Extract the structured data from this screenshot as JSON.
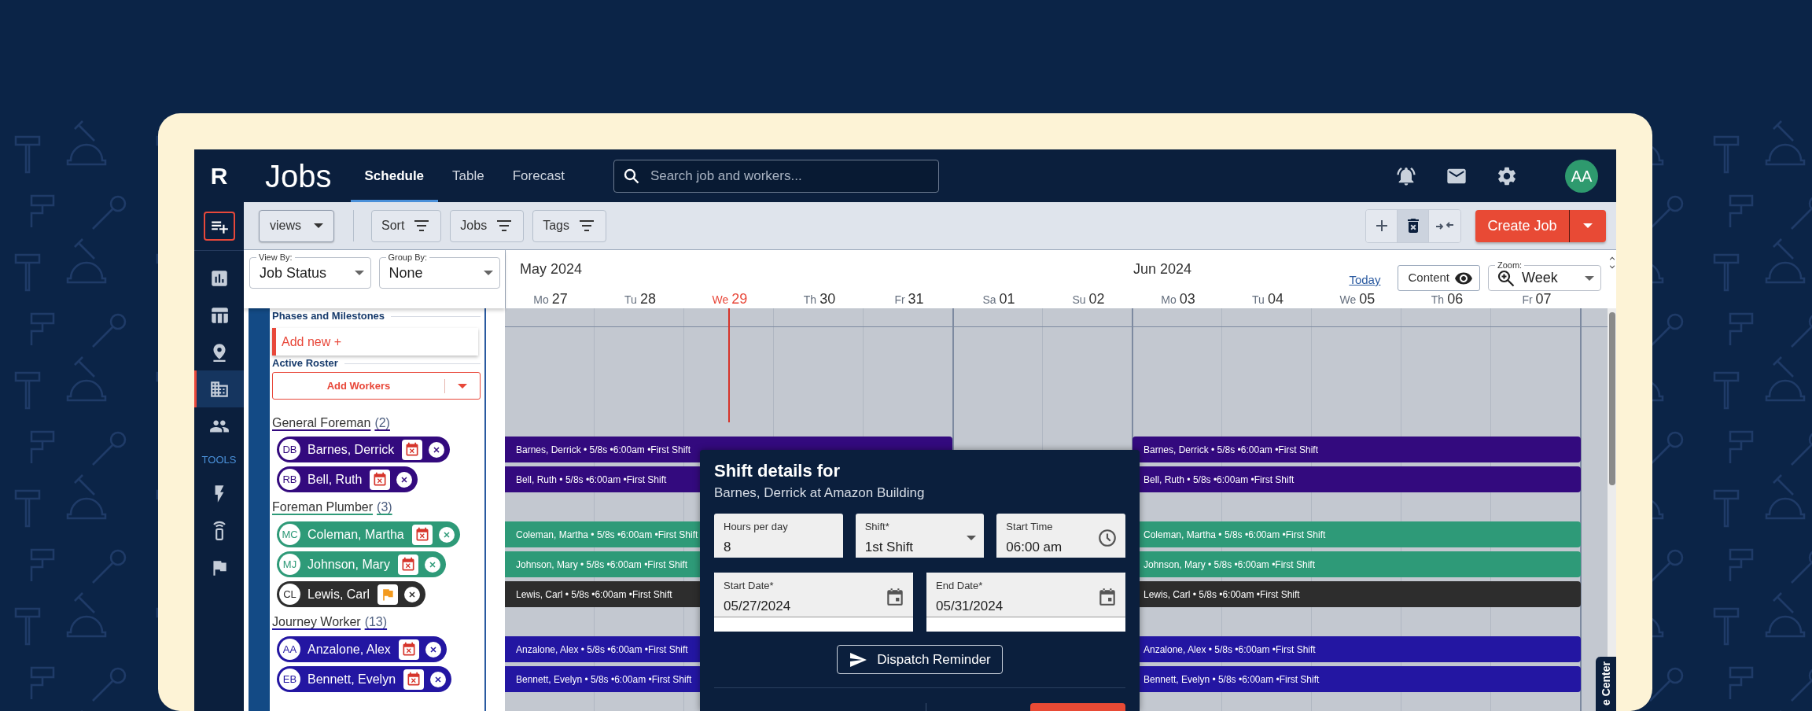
{
  "app": {
    "logo": "R",
    "title": "Jobs"
  },
  "tabs": [
    {
      "label": "Schedule",
      "selected": true
    },
    {
      "label": "Table",
      "selected": false
    },
    {
      "label": "Forecast",
      "selected": false
    }
  ],
  "search": {
    "placeholder": "Search job and workers..."
  },
  "user": {
    "initials": "AA"
  },
  "rail": {
    "items": [
      {
        "kind": "chart",
        "selected": false
      },
      {
        "kind": "table",
        "selected": false
      },
      {
        "kind": "pin",
        "selected": false
      },
      {
        "kind": "building",
        "selected": true
      },
      {
        "kind": "people",
        "selected": false
      }
    ],
    "tools_label": "TOOLS",
    "tools": [
      {
        "kind": "bolt"
      },
      {
        "kind": "remote"
      },
      {
        "kind": "flag"
      }
    ]
  },
  "toolbar": {
    "views": "views",
    "filters": [
      "Sort",
      "Jobs",
      "Tags"
    ],
    "actions": [
      {
        "kind": "add",
        "pressed": false
      },
      {
        "kind": "delete",
        "pressed": true
      },
      {
        "kind": "merge",
        "pressed": false
      }
    ],
    "create": "Create Job"
  },
  "view_by": {
    "label": "View By:",
    "value": "Job Status"
  },
  "group_by": {
    "label": "Group By:",
    "value": "None"
  },
  "calendar": {
    "months": [
      "May 2024",
      "Jun 2024"
    ],
    "today_link": "Today",
    "content_button": "Content",
    "zoom": {
      "label": "Zoom:",
      "value": "Week"
    },
    "days": [
      {
        "weekday": "Mo",
        "date": "27",
        "today": false
      },
      {
        "weekday": "Tu",
        "date": "28",
        "today": false
      },
      {
        "weekday": "We",
        "date": "29",
        "today": true
      },
      {
        "weekday": "Th",
        "date": "30",
        "today": false
      },
      {
        "weekday": "Fr",
        "date": "31",
        "today": false
      },
      {
        "weekday": "Sa",
        "date": "01",
        "today": false
      },
      {
        "weekday": "Su",
        "date": "02",
        "today": false
      },
      {
        "weekday": "Mo",
        "date": "03",
        "today": false
      },
      {
        "weekday": "Tu",
        "date": "04",
        "today": false
      },
      {
        "weekday": "We",
        "date": "05",
        "today": false
      },
      {
        "weekday": "Th",
        "date": "06",
        "today": false
      },
      {
        "weekday": "Fr",
        "date": "07",
        "today": false
      }
    ]
  },
  "roster": {
    "phases_heading": "Phases and Milestones",
    "add_new": "Add new +",
    "heading": "Active Roster",
    "add_workers": "Add Workers",
    "groups": [
      {
        "title": "General Foreman",
        "count": "(2)",
        "color": "#330a7e",
        "workers": [
          {
            "initials": "DB",
            "name": "Barnes, Derrick",
            "color": "#330a7e",
            "kind": "calendar",
            "shifts": [
              "Barnes, Derrick • 5/8s •6:00am •First Shift",
              "Barnes, Derrick • 5/8s •6:00am •First Shift"
            ]
          },
          {
            "initials": "RB",
            "name": "Bell, Ruth",
            "color": "#330a7e",
            "kind": "calendar",
            "shifts": [
              "Bell, Ruth • 5/8s •6:00am •First Shift",
              "Bell, Ruth • 5/8s •6:00am •First Shift"
            ]
          }
        ]
      },
      {
        "title": "Foreman Plumber",
        "count": "(3)",
        "color": "#2e9a78",
        "workers": [
          {
            "initials": "MC",
            "name": "Coleman, Martha",
            "color": "#2e9a78",
            "kind": "calendar",
            "shifts": [
              "Coleman, Martha • 5/8s •6:00am •First Shift",
              "Coleman, Martha • 5/8s •6:00am •First Shift"
            ]
          },
          {
            "initials": "MJ",
            "name": "Johnson, Mary",
            "color": "#2e9a78",
            "kind": "calendar",
            "shifts": [
              "Johnson, Mary • 5/8s •6:00am •First Shift",
              "Johnson, Mary • 5/8s •6:00am •First Shift"
            ]
          },
          {
            "initials": "CL",
            "name": "Lewis, Carl",
            "color": "#2d2d2d",
            "kind": "flag",
            "shifts": [
              "Lewis, Carl • 5/8s •6:00am •First Shift",
              "Lewis, Carl • 5/8s •6:00am •First Shift"
            ]
          }
        ]
      },
      {
        "title": "Journey Worker",
        "count": "(13)",
        "color": "#2316a2",
        "workers": [
          {
            "initials": "AA",
            "name": "Anzalone, Alex",
            "color": "#2316a2",
            "kind": "calendar",
            "shifts": [
              "Anzalone, Alex • 5/8s •6:00am •First Shift",
              "Anzalone, Alex • 5/8s •6:00am •First Shift"
            ]
          },
          {
            "initials": "EB",
            "name": "Bennett, Evelyn",
            "color": "#2316a2",
            "kind": "calendar",
            "shifts": [
              "Bennett, Evelyn • 5/8s •6:00am •First Shift",
              "Bennett, Evelyn • 5/8s •6:00am •First Shift"
            ]
          }
        ]
      }
    ]
  },
  "shift_dialog": {
    "title": "Shift details for",
    "subtitle": "Barnes, Derrick at Amazon Building",
    "fields": [
      {
        "kind": "text",
        "label": "Hours per day",
        "value": "8"
      },
      {
        "kind": "select",
        "label": "Shift*",
        "value": "1st Shift"
      },
      {
        "kind": "time",
        "label": "Start Time",
        "value": "06:00 am"
      },
      {
        "kind": "date",
        "label": "Start Date*",
        "value": "05/27/2024"
      },
      {
        "kind": "date",
        "label": "End Date*",
        "value": "05/31/2024"
      }
    ],
    "dispatch": "Dispatch Reminder"
  },
  "side_tab": "e Center"
}
